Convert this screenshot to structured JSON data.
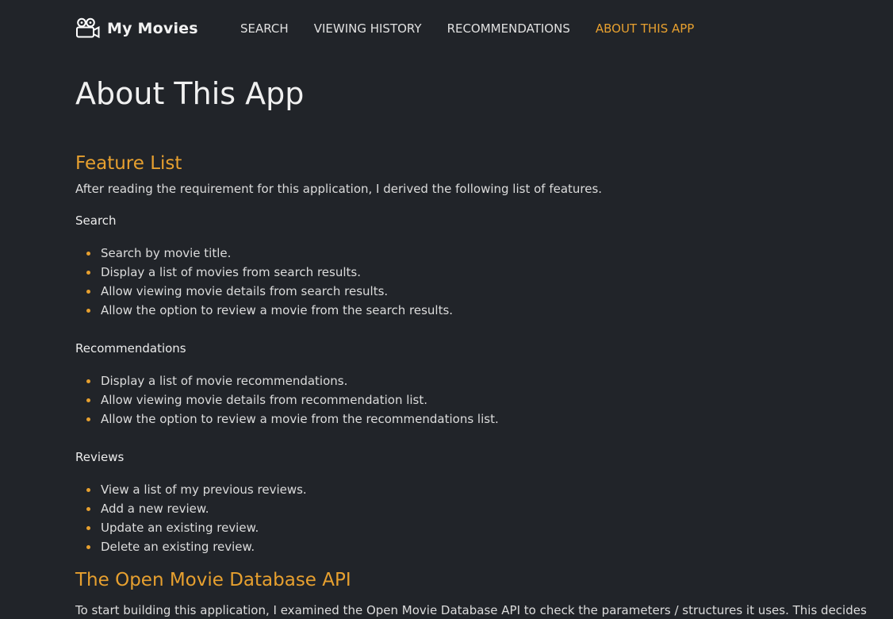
{
  "nav": {
    "brand": "My Movies",
    "links": [
      {
        "label": "SEARCH",
        "active": false
      },
      {
        "label": "VIEWING HISTORY",
        "active": false
      },
      {
        "label": "RECOMMENDATIONS",
        "active": false
      },
      {
        "label": "ABOUT THIS APP",
        "active": true
      }
    ],
    "brand_icon": "movie-camera-icon",
    "accent_color": "#e7a02f"
  },
  "page": {
    "title": "About This App",
    "features_heading": "Feature List",
    "intro": "After reading the requirement for this application, I derived the following list of features.",
    "groups": [
      {
        "title": "Search",
        "items": [
          "Search by movie title.",
          "Display a list of movies from search results.",
          "Allow viewing movie details from search results.",
          "Allow the option to review a movie from the search results."
        ]
      },
      {
        "title": "Recommendations",
        "items": [
          "Display a list of movie recommendations.",
          "Allow viewing movie details from recommendation list.",
          "Allow the option to review a movie from the recommendations list."
        ]
      },
      {
        "title": "Reviews",
        "items": [
          "View a list of my previous reviews.",
          "Add a new review.",
          "Update an existing review.",
          "Delete an existing review."
        ]
      }
    ],
    "api_heading": "The Open Movie Database API",
    "api_text": "To start building this application, I examined the Open Movie Database API to check the parameters / structures it uses. This decides"
  },
  "colors": {
    "background": "#212429",
    "accent": "#e7a02f",
    "text": "#dcdcdc"
  }
}
